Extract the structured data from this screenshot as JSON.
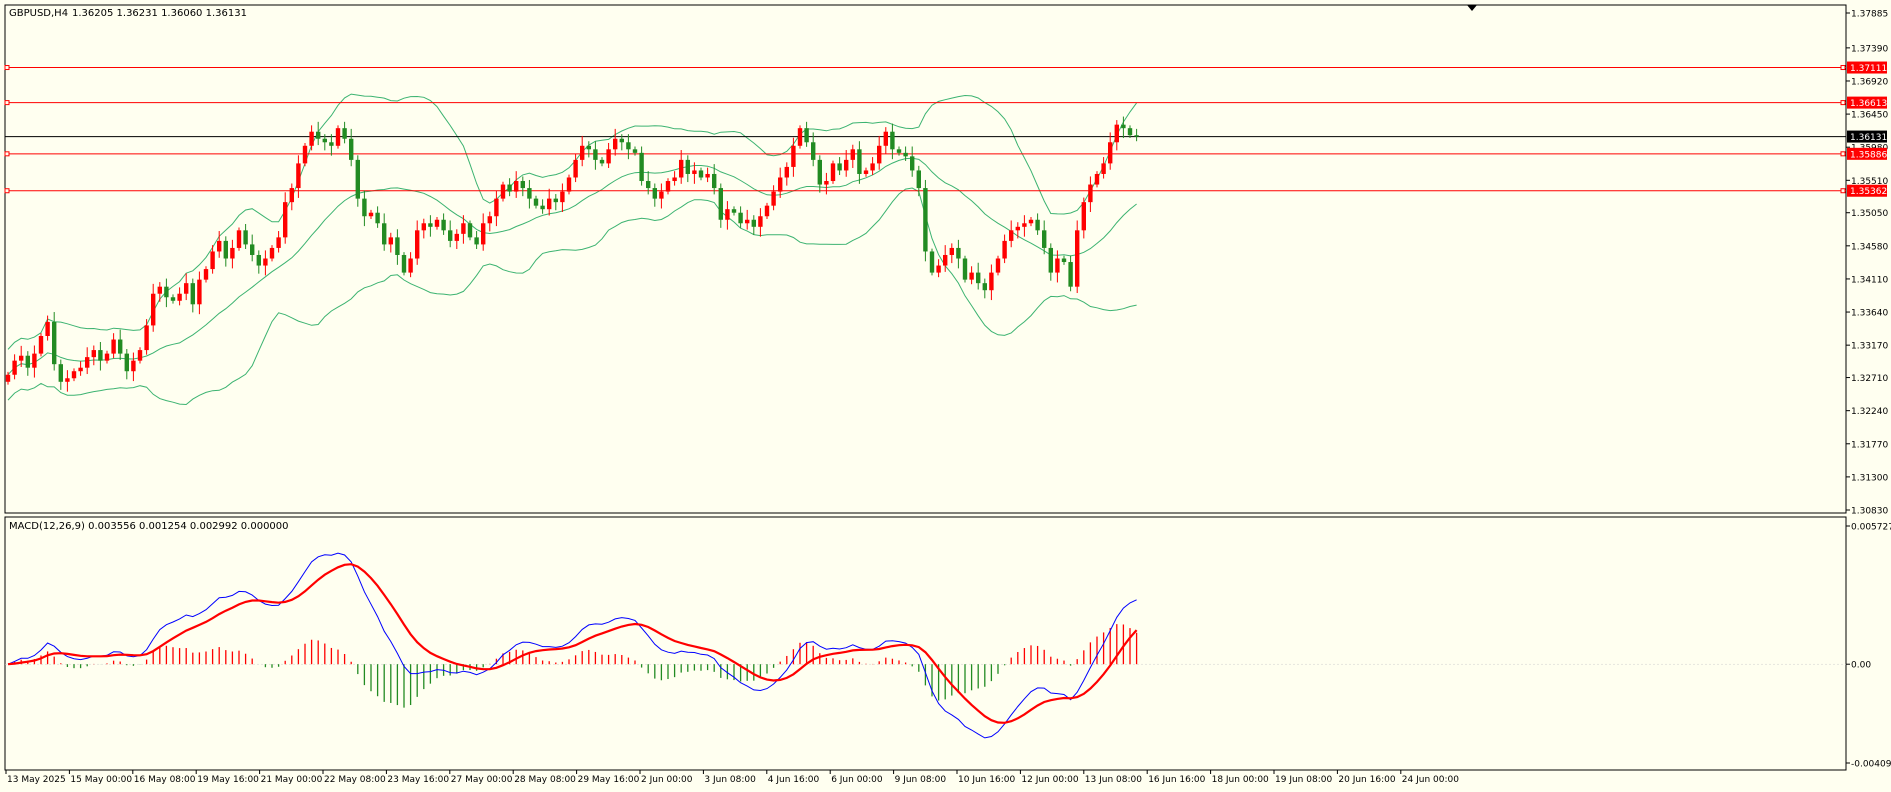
{
  "price_header": {
    "symbol": "GBPUSD,H4",
    "ohlc": "1.36205 1.36231 1.36060 1.36131"
  },
  "macd_header": {
    "label": "MACD(12,26,9) 0.003556 0.001254 0.002992 0.000000"
  },
  "colors": {
    "background": "#fffff0",
    "bull": "#ff0000",
    "bear": "#228b22",
    "bands": "#3cb371",
    "hline": "#ff0000",
    "current": "#000000",
    "macd": "#0000ff",
    "signal": "#ff0000",
    "hist_pos": "#ff0000",
    "hist_neg": "#228b22"
  },
  "chart_data": [
    {
      "type": "candlestick",
      "panel": "price",
      "ylim": [
        1.3083,
        1.37885
      ],
      "y_ticks": [
        "1.37885",
        "1.37390",
        "1.36920",
        "1.36450",
        "1.35980",
        "1.35510",
        "1.35050",
        "1.34580",
        "1.34110",
        "1.33640",
        "1.33170",
        "1.32710",
        "1.32240",
        "1.31770",
        "1.31300",
        "1.30830"
      ],
      "x_labels": [
        "13 May 2025",
        "15 May 00:00",
        "16 May 08:00",
        "19 May 16:00",
        "21 May 00:00",
        "22 May 08:00",
        "23 May 16:00",
        "27 May 00:00",
        "28 May 08:00",
        "29 May 16:00",
        "2 Jun 00:00",
        "3 Jun 08:00",
        "4 Jun 16:00",
        "6 Jun 00:00",
        "9 Jun 08:00",
        "10 Jun 16:00",
        "12 Jun 00:00",
        "13 Jun 08:00",
        "16 Jun 16:00",
        "18 Jun 00:00",
        "19 Jun 08:00",
        "20 Jun 16:00",
        "24 Jun 00:00"
      ],
      "close": [
        1.3275,
        1.3295,
        1.3302,
        1.3285,
        1.3305,
        1.333,
        1.335,
        1.329,
        1.3265,
        1.327,
        1.328,
        1.3285,
        1.33,
        1.331,
        1.3295,
        1.3305,
        1.3325,
        1.3305,
        1.328,
        1.3295,
        1.331,
        1.3345,
        1.339,
        1.34,
        1.3385,
        1.338,
        1.339,
        1.3405,
        1.3375,
        1.341,
        1.3425,
        1.345,
        1.3465,
        1.344,
        1.3455,
        1.348,
        1.346,
        1.3445,
        1.343,
        1.344,
        1.3455,
        1.347,
        1.352,
        1.354,
        1.3575,
        1.36,
        1.362,
        1.361,
        1.3605,
        1.36,
        1.3625,
        1.361,
        1.358,
        1.3525,
        1.35,
        1.3505,
        1.349,
        1.346,
        1.347,
        1.3445,
        1.342,
        1.344,
        1.348,
        1.349,
        1.3485,
        1.3495,
        1.348,
        1.3465,
        1.3475,
        1.349,
        1.347,
        1.346,
        1.349,
        1.35,
        1.3525,
        1.3545,
        1.3535,
        1.355,
        1.354,
        1.3525,
        1.3515,
        1.351,
        1.3525,
        1.352,
        1.3535,
        1.3555,
        1.358,
        1.36,
        1.3595,
        1.358,
        1.3575,
        1.3595,
        1.361,
        1.3605,
        1.3595,
        1.359,
        1.355,
        1.354,
        1.3525,
        1.3535,
        1.355,
        1.3555,
        1.358,
        1.356,
        1.3565,
        1.3555,
        1.356,
        1.354,
        1.3495,
        1.351,
        1.3505,
        1.349,
        1.3495,
        1.3485,
        1.35,
        1.3515,
        1.3535,
        1.3555,
        1.357,
        1.36,
        1.3625,
        1.3605,
        1.358,
        1.3545,
        1.355,
        1.3575,
        1.3565,
        1.358,
        1.3595,
        1.356,
        1.3565,
        1.3575,
        1.36,
        1.362,
        1.3595,
        1.359,
        1.3585,
        1.3565,
        1.354,
        1.345,
        1.342,
        1.343,
        1.3445,
        1.3455,
        1.344,
        1.341,
        1.342,
        1.3405,
        1.3395,
        1.342,
        1.344,
        1.3465,
        1.348,
        1.3485,
        1.349,
        1.3495,
        1.348,
        1.3455,
        1.342,
        1.344,
        1.3435,
        1.34,
        1.348,
        1.352,
        1.3545,
        1.356,
        1.3575,
        1.3605,
        1.363,
        1.3625,
        1.3615,
        1.3613
      ],
      "series": [
        {
          "name": "1.37111",
          "level": 1.37111
        },
        {
          "name": "1.36613",
          "level": 1.36613
        },
        {
          "name": "1.35886",
          "level": 1.35886
        },
        {
          "name": "1.35362",
          "level": 1.35362
        },
        {
          "name": "1.36131",
          "level": 1.36131
        }
      ]
    },
    {
      "type": "line",
      "panel": "macd",
      "ylim": [
        -0.004094,
        0.005727
      ],
      "y_ticks": [
        "0.005727",
        "0.00",
        "-0.004094"
      ]
    }
  ]
}
